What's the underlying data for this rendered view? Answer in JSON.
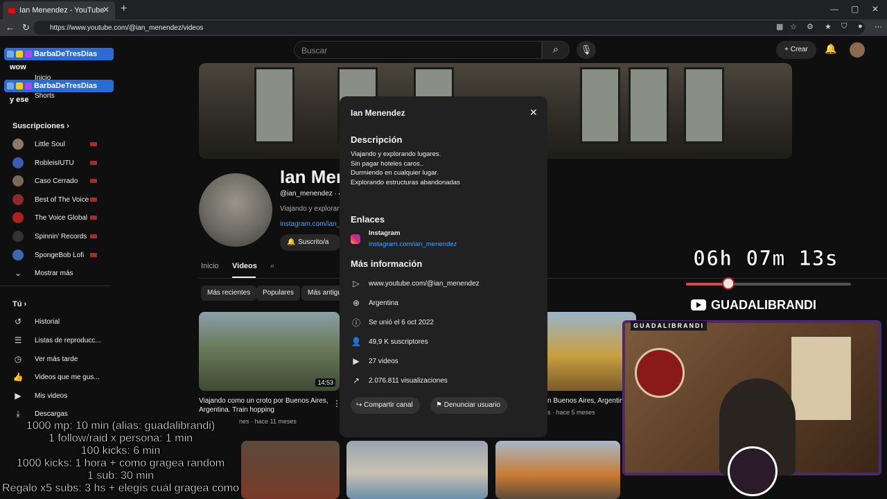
{
  "browser": {
    "tab_title": "Ian Menendez - YouTube",
    "url": "https://www.youtube.com/@ian_menendez/videos"
  },
  "youtube": {
    "search_placeholder": "Buscar",
    "create_label": "Crear"
  },
  "sidebar": {
    "items_top": [
      "Inicio",
      "Shorts"
    ],
    "subscriptions_title": "Suscripciones",
    "subscriptions": [
      {
        "name": "Little Soul",
        "color": "#8a7a6a"
      },
      {
        "name": "RobleisIUTU",
        "color": "#3b5bb5"
      },
      {
        "name": "Caso Cerrado",
        "color": "#7a6a5a"
      },
      {
        "name": "Best of The Voice",
        "color": "#8a2a2a"
      },
      {
        "name": "The Voice Global",
        "color": "#b02020"
      },
      {
        "name": "Spinnin' Records",
        "color": "#333333"
      },
      {
        "name": "SpongeBob Lofi",
        "color": "#3a6ab0"
      }
    ],
    "show_more": "Mostrar más",
    "you_title": "Tú",
    "you_items": [
      {
        "label": "Historial",
        "icon": "history-icon"
      },
      {
        "label": "Listas de reproducc...",
        "icon": "playlist-icon"
      },
      {
        "label": "Ver más tarde",
        "icon": "clock-icon"
      },
      {
        "label": "Videos que me gus...",
        "icon": "thumbs-up-icon"
      },
      {
        "label": "Mis videos",
        "icon": "video-icon"
      },
      {
        "label": "Descargas",
        "icon": "download-icon"
      }
    ]
  },
  "chat": {
    "user": "BarbaDeTresDias",
    "messages": [
      "wow",
      "y ese"
    ]
  },
  "channel": {
    "name": "Ian Menendez",
    "handle": "@ian_menendez · 49",
    "description_preview": "Viajando y explorando",
    "link_preview": "instagram.com/ian_m",
    "subscribed_label": "Suscrito/a",
    "tabs": [
      "Inicio",
      "Videos"
    ],
    "chips": [
      "Más recientes",
      "Populares",
      "Más antiguo"
    ]
  },
  "videos": [
    {
      "title": "Viajando como un croto por Buenos Aires, Argentina. Train hopping",
      "meta": "nes · hace 11 meses",
      "duration": "14:53"
    },
    {
      "title": "n Buenos Aires, Argentina",
      "meta": "s · hace 5 meses",
      "duration": ""
    }
  ],
  "modal": {
    "title": "Ian Menendez",
    "description_title": "Descripción",
    "description_lines": [
      "Viajando y explorando lugares.",
      "Sin pagar hoteles caros..",
      "Durmiendo en cualquier lugar.",
      "Explorando estructuras abandonadas"
    ],
    "links_title": "Enlaces",
    "link_name": "Instagram",
    "link_url": "instagram.com/ian_menendez",
    "more_info_title": "Más información",
    "info": [
      {
        "text": "www.youtube.com/@ian_menendez",
        "icon": "play-icon"
      },
      {
        "text": "Argentina",
        "icon": "globe-icon"
      },
      {
        "text": "Se unió el 6 oct 2022",
        "icon": "info-icon"
      },
      {
        "text": "49,9 K suscriptores",
        "icon": "person-icon"
      },
      {
        "text": "27 videos",
        "icon": "video-icon"
      },
      {
        "text": "2.076.811 visualizaciones",
        "icon": "trending-icon"
      }
    ],
    "share_label": "Compartir canal",
    "report_label": "Denunciar usuario"
  },
  "stream": {
    "timer": "06h 07m 13s",
    "progress": 0.26,
    "channel": "GUADALIBRANDI",
    "cam_label": "GUADALIBRANDI",
    "rules": [
      "1000 mp: 10 min (alias: guadalibrandi)",
      "1 follow/raid x persona: 1 min",
      "100 kicks: 6 min",
      "1000 kicks: 1 hora + como gragea random",
      "1 sub: 30 min",
      "Regalo x5 subs: 3 hs + elegís cuál gragea como"
    ]
  }
}
